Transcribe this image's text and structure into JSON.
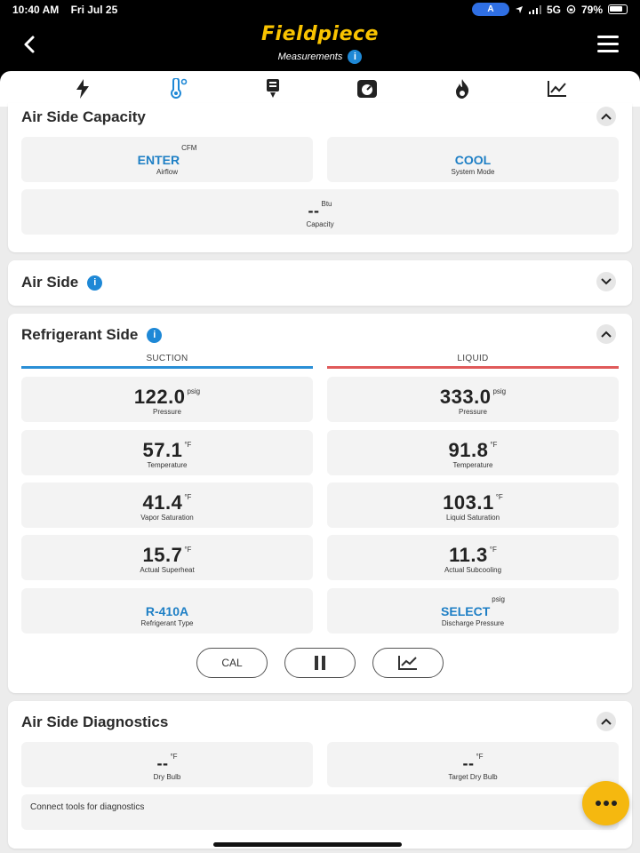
{
  "status": {
    "time": "10:40 AM",
    "date": "Fri Jul 25",
    "pill": "A",
    "network": "5G",
    "battery": "79%"
  },
  "header": {
    "logo": "Fieldpiece",
    "subtitle": "Measurements",
    "info": "i"
  },
  "tabs": [
    {
      "icon": "lightning-icon"
    },
    {
      "icon": "thermometer-icon",
      "active": true
    },
    {
      "icon": "charge-icon"
    },
    {
      "icon": "scale-icon"
    },
    {
      "icon": "flame-icon"
    },
    {
      "icon": "chart-icon"
    }
  ],
  "air_side_capacity": {
    "title": "Air Side Capacity",
    "airflow": {
      "value": "ENTER",
      "unit": "CFM",
      "label": "Airflow"
    },
    "system_mode": {
      "value": "COOL",
      "label": "System Mode"
    },
    "capacity": {
      "value": "--",
      "unit": "Btu",
      "label": "Capacity"
    }
  },
  "air_side": {
    "title": "Air Side",
    "info": "i"
  },
  "refrigerant_side": {
    "title": "Refrigerant Side",
    "info": "i",
    "suction_header": "SUCTION",
    "liquid_header": "LIQUID",
    "suction_color": "#2a8fd6",
    "liquid_color": "#e05a5a",
    "suction": [
      {
        "value": "122.0",
        "unit": "psig",
        "label": "Pressure"
      },
      {
        "value": "57.1",
        "unit": "°F",
        "label": "Temperature"
      },
      {
        "value": "41.4",
        "unit": "°F",
        "label": "Vapor Saturation"
      },
      {
        "value": "15.7",
        "unit": "°F",
        "label": "Actual Superheat"
      },
      {
        "value": "R-410A",
        "unit": "",
        "label": "Refrigerant Type"
      }
    ],
    "liquid": [
      {
        "value": "333.0",
        "unit": "psig",
        "label": "Pressure"
      },
      {
        "value": "91.8",
        "unit": "°F",
        "label": "Temperature"
      },
      {
        "value": "103.1",
        "unit": "°F",
        "label": "Liquid Saturation"
      },
      {
        "value": "11.3",
        "unit": "°F",
        "label": "Actual Subcooling"
      },
      {
        "value": "SELECT",
        "unit": "psig",
        "label": "Discharge Pressure"
      }
    ],
    "controls": {
      "cal": "CAL"
    }
  },
  "air_side_diagnostics": {
    "title": "Air Side Diagnostics",
    "dry_bulb": {
      "value": "--",
      "unit": "°F",
      "label": "Dry Bulb"
    },
    "target_dry_bulb": {
      "value": "--",
      "unit": "°F",
      "label": "Target Dry Bulb"
    },
    "message": "Connect tools for diagnostics"
  },
  "colors": {
    "brand": "#f9c300",
    "link": "#1e7fc5",
    "fab": "#f5b80f"
  }
}
